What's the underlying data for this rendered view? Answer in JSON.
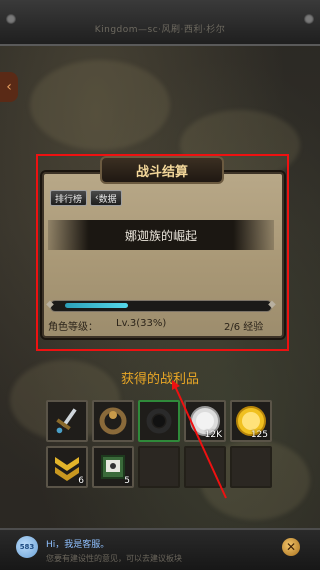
{
  "header": {
    "title": "Kingdom—sc·风刷·西利·杉尔"
  },
  "panel": {
    "title": "战斗结算",
    "buttons": {
      "ranking": "排行榜",
      "data": "数据"
    },
    "banner_text": "娜迦族的崛起",
    "progress": {
      "fraction": 0.33
    },
    "stats": {
      "role_level_label": "角色等级：",
      "level_value": "Lv.3(33%)",
      "exp_value": "2/6 经验"
    }
  },
  "loot": {
    "title": "获得的战利品",
    "items": [
      {
        "icon": "sword-icon",
        "count": ""
      },
      {
        "icon": "brown-ring-icon",
        "count": ""
      },
      {
        "icon": "black-ring-icon",
        "count": ""
      },
      {
        "icon": "silver-coin-icon",
        "count": "12K"
      },
      {
        "icon": "gold-coin-icon",
        "count": "125"
      },
      {
        "icon": "rank-chevron-icon",
        "count": "6"
      },
      {
        "icon": "book-icon",
        "count": "5"
      },
      {
        "icon": "",
        "count": ""
      },
      {
        "icon": "",
        "count": ""
      },
      {
        "icon": "",
        "count": ""
      }
    ]
  },
  "chat": {
    "avatar_label": "583",
    "greeting": "Hi，我是客服。",
    "subtext": "您要有建设性的意见，可以去建议板块"
  },
  "colors": {
    "accent_red": "#e11",
    "loot_title": "#e9a726",
    "progress": "#56d8ea"
  }
}
